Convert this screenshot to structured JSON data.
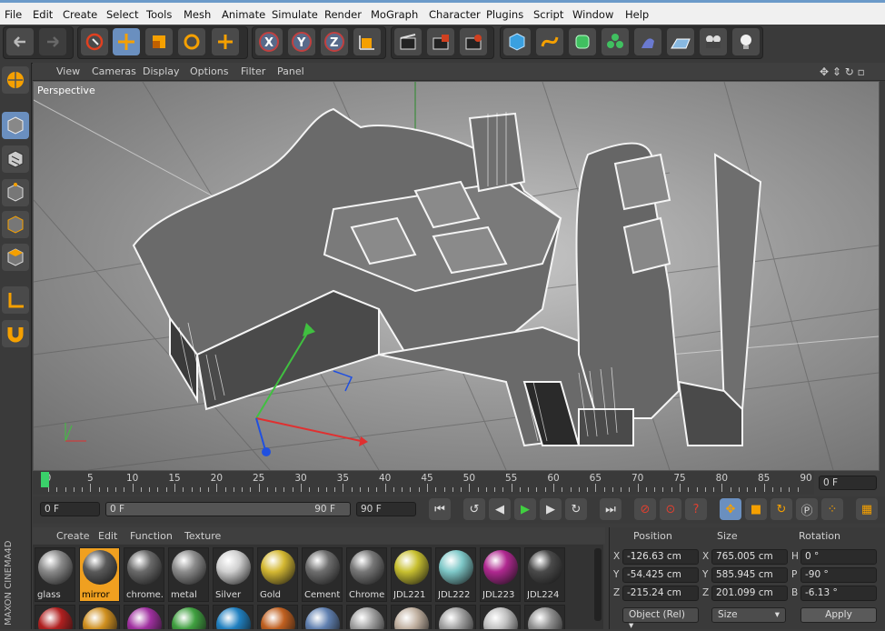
{
  "menu": [
    "File",
    "Edit",
    "Create",
    "Select",
    "Tools",
    "Mesh",
    "Animate",
    "Simulate",
    "Render",
    "MoGraph",
    "Character",
    "Plugins",
    "Script",
    "Window",
    "Help"
  ],
  "toolbar_icons": [
    "undo-icon",
    "redo-icon",
    "live-selection-icon",
    "move-icon",
    "scale-icon",
    "rotate-icon",
    "add-icon",
    "x-axis-icon",
    "y-axis-icon",
    "z-axis-icon",
    "coordinate-system-icon",
    "render-view-icon",
    "render-picture-viewer-icon",
    "render-settings-icon",
    "cube-icon",
    "spline-pen-icon",
    "subdivision-surface-icon",
    "cloner-icon",
    "deformer-icon",
    "floor-icon",
    "camera-icon",
    "light-icon"
  ],
  "toolbar_axis_labels": [
    "X",
    "Y",
    "Z"
  ],
  "viewport": {
    "menu": [
      "View",
      "Cameras",
      "Display",
      "Options",
      "Filter",
      "Panel"
    ],
    "label": "Perspective"
  },
  "timeline": {
    "ticks": [
      "0",
      "5",
      "10",
      "15",
      "20",
      "25",
      "30",
      "35",
      "40",
      "45",
      "50",
      "55",
      "60",
      "65",
      "70",
      "75",
      "80",
      "85",
      "90"
    ],
    "current_frame_field": "0 F",
    "start_field": "0 F",
    "range_start": "0 F",
    "range_end": "90 F",
    "end_field": "90 F",
    "min_frame_field": "0 F"
  },
  "materials": {
    "menu": [
      "Create",
      "Edit",
      "Function",
      "Texture"
    ],
    "items": [
      {
        "label": "glass",
        "color": "#8a8a8a",
        "selected": false
      },
      {
        "label": "mirror",
        "color": "#5a5a5a",
        "selected": true
      },
      {
        "label": "chrome.",
        "color": "#6a6a6a",
        "selected": false
      },
      {
        "label": "metal",
        "color": "#8c8c8c",
        "selected": false
      },
      {
        "label": "Silver",
        "color": "#d0d0d0",
        "selected": false
      },
      {
        "label": "Gold",
        "color": "#d4b832",
        "selected": false
      },
      {
        "label": "Cement",
        "color": "#6e6e6e",
        "selected": false
      },
      {
        "label": "Chrome",
        "color": "#777777",
        "selected": false
      },
      {
        "label": "JDL221",
        "color": "#c8c030",
        "selected": false
      },
      {
        "label": "JDL222",
        "color": "#7ec8c8",
        "selected": false
      },
      {
        "label": "JDL223",
        "color": "#b02890",
        "selected": false
      },
      {
        "label": "JDL224",
        "color": "#4a4a4a",
        "selected": false
      }
    ],
    "second_row_colors": [
      "#b02020",
      "#d09020",
      "#a030a0",
      "#40a040",
      "#2080c0",
      "#c06020",
      "#6080b0",
      "#a0a0a0",
      "#c0b0a0",
      "#a0a0a0",
      "#c0c0c0",
      "#909090"
    ]
  },
  "coordinates": {
    "headers": {
      "position": "Position",
      "size": "Size",
      "rotation": "Rotation"
    },
    "rows": [
      {
        "axis": "X",
        "pos": "-126.63 cm",
        "size_axis": "X",
        "size": "765.005 cm",
        "rot_axis": "H",
        "rot": "0 °"
      },
      {
        "axis": "Y",
        "pos": "-54.425 cm",
        "size_axis": "Y",
        "size": "585.945 cm",
        "rot_axis": "P",
        "rot": "-90 °"
      },
      {
        "axis": "Z",
        "pos": "-215.24 cm",
        "size_axis": "Z",
        "size": "201.099 cm",
        "rot_axis": "B",
        "rot": "-6.13 °"
      }
    ],
    "mode_dropdown": "Object (Rel)",
    "size_dropdown": "Size",
    "apply_label": "Apply"
  },
  "brand": "MAXON CINEMA4D"
}
